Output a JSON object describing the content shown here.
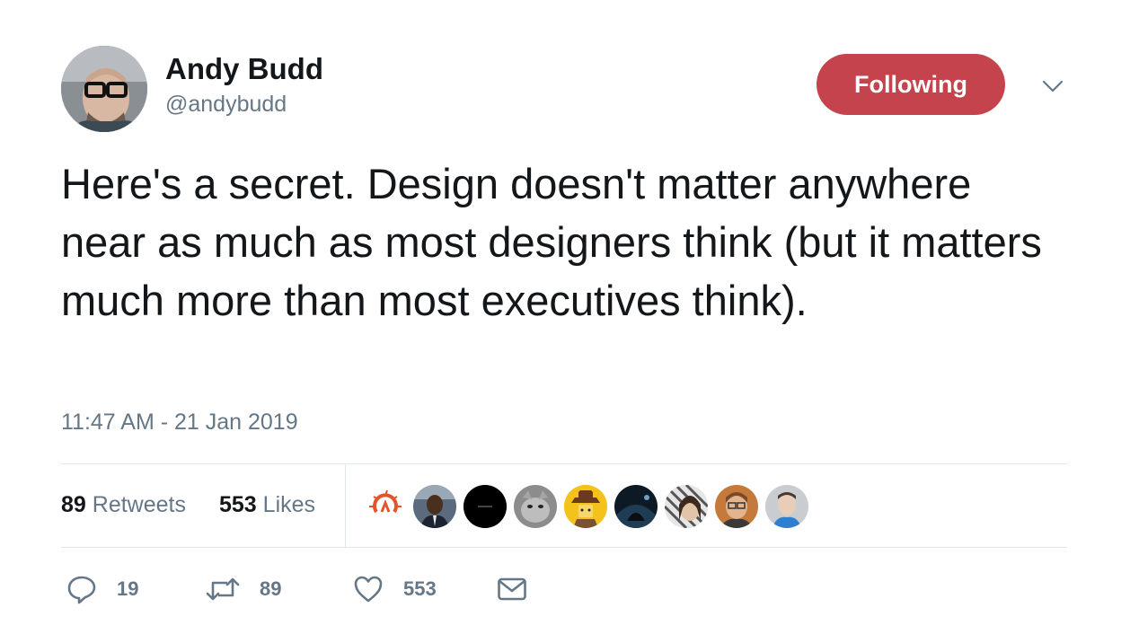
{
  "author": {
    "name": "Andy Budd",
    "handle": "@andybudd"
  },
  "follow_button": {
    "label": "Following",
    "color": "#c4434c"
  },
  "tweet": {
    "text": "Here's a secret. Design doesn't matter anywhere near as much as most designers think (but it matters much more than most executives think).",
    "timestamp": "11:47 AM - 21 Jan 2019"
  },
  "stats": {
    "retweets_count": "89",
    "retweets_label": "Retweets",
    "likes_count": "553",
    "likes_label": "Likes"
  },
  "actions": {
    "reply_count": "19",
    "retweet_count": "89",
    "like_count": "553"
  },
  "icons": {
    "caret": "chevron-down-icon",
    "reply": "reply-icon",
    "retweet": "retweet-icon",
    "like": "heart-icon",
    "dm": "envelope-icon"
  },
  "colors": {
    "text": "#14171a",
    "secondary": "#657786",
    "border": "#e1e8ed"
  }
}
